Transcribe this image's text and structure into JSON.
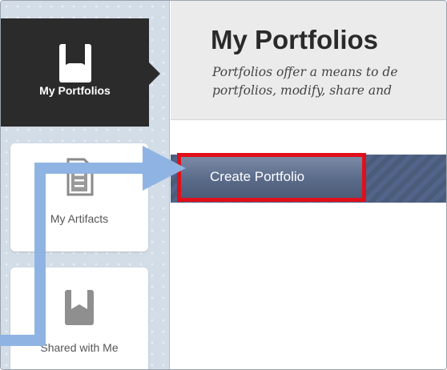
{
  "sidebar": {
    "active": {
      "label": "My Portfolios",
      "icon": "portfolio-book-icon"
    },
    "items": [
      {
        "label": "My Artifacts",
        "icon": "document-artifact-icon"
      },
      {
        "label": "Shared with Me",
        "icon": "shared-book-icon"
      }
    ]
  },
  "main": {
    "title": "My Portfolios",
    "description_line1": "Portfolios offer a means to de",
    "description_line2": "portfolios, modify, share and",
    "create_button_label": "Create Portfolio"
  },
  "colors": {
    "highlight_border": "#e0101a",
    "arrow": "#8fb4e3",
    "active_nav": "#2b2b2b",
    "toolbar": "#4a5c7a"
  }
}
